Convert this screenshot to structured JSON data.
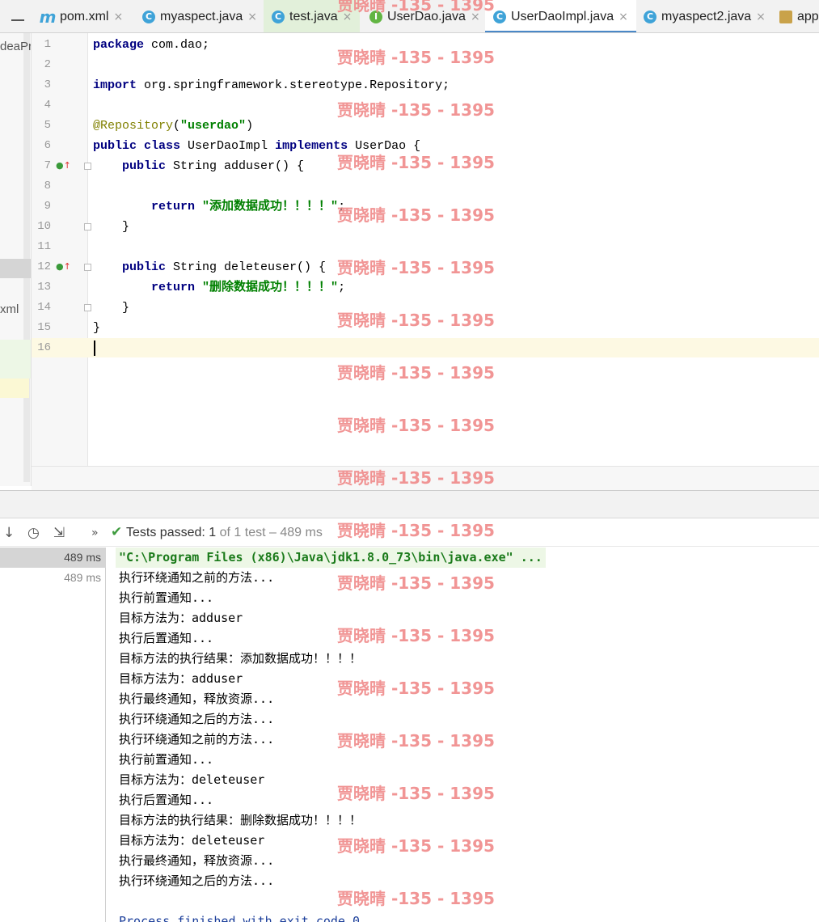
{
  "tabs": [
    {
      "label": "pom.xml",
      "icon": "m",
      "icon_name": "maven-icon"
    },
    {
      "label": "myaspect.java",
      "icon": "C",
      "icon_name": "class-icon"
    },
    {
      "label": "test.java",
      "icon": "C",
      "icon_name": "class-icon"
    },
    {
      "label": "UserDao.java",
      "icon": "I",
      "icon_name": "interface-icon"
    },
    {
      "label": "UserDaoImpl.java",
      "icon": "C",
      "icon_name": "class-icon"
    },
    {
      "label": "myaspect2.java",
      "icon": "C",
      "icon_name": "class-icon"
    },
    {
      "label": "app",
      "icon": "",
      "icon_name": "spring-xml-icon"
    }
  ],
  "tab_close_glyph": "×",
  "project_strip": {
    "text_1": "deaPr",
    "text_2": "xml"
  },
  "editor": {
    "line_numbers": [
      "1",
      "2",
      "3",
      "4",
      "5",
      "6",
      "7",
      "8",
      "9",
      "10",
      "11",
      "12",
      "13",
      "14",
      "15",
      "16"
    ],
    "lines": [
      "package com.dao;",
      "",
      "import org.springframework.stereotype.Repository;",
      "",
      "@Repository(\"userdao\")",
      "public class UserDaoImpl implements UserDao {",
      "    public String adduser() {",
      "",
      "        return \"添加数据成功！！！！\";",
      "    }",
      "",
      "    public String deleteuser() {",
      "        return \"删除数据成功！！！！\";",
      "    }",
      "}",
      ""
    ]
  },
  "test_toolbar": {
    "status_label": "Tests passed:",
    "passed": "1",
    "rest": "of 1 test – 489 ms",
    "more": "»"
  },
  "test_tree": [
    {
      "time": "489 ms"
    },
    {
      "time": "489 ms"
    }
  ],
  "console": {
    "command": "\"C:\\Program Files (x86)\\Java\\jdk1.8.0_73\\bin\\java.exe\" ...",
    "output": [
      "执行环绕通知之前的方法...",
      "执行前置通知...",
      "目标方法为：adduser",
      "执行后置通知...",
      "目标方法的执行结果：添加数据成功！！！！",
      "目标方法为：adduser",
      "执行最终通知，释放资源...",
      "执行环绕通知之后的方法...",
      "执行环绕通知之前的方法...",
      "执行前置通知...",
      "目标方法为：deleteuser",
      "执行后置通知...",
      "目标方法的执行结果：删除数据成功！！！！",
      "目标方法为：deleteuser",
      "执行最终通知，释放资源...",
      "执行环绕通知之后的方法..."
    ],
    "exit": "Process finished with exit code 0"
  },
  "watermark": "贾晓晴 -135 - 1395"
}
